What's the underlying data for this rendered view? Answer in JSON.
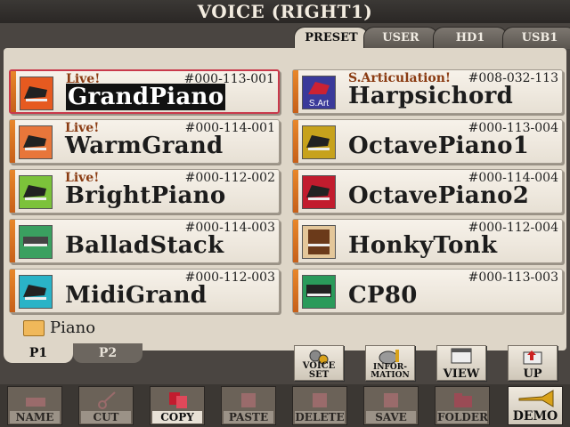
{
  "title": "VOICE (RIGHT1)",
  "tabs": [
    {
      "label": "PRESET",
      "active": true
    },
    {
      "label": "USER",
      "active": false
    },
    {
      "label": "HD1",
      "active": false
    },
    {
      "label": "USB1",
      "active": false
    }
  ],
  "voices": [
    {
      "tag": "Live!",
      "number": "#000-113-001",
      "name": "GrandPiano",
      "selected": true
    },
    {
      "tag": "S.Articulation!",
      "number": "#008-032-113",
      "name": "Harpsichord",
      "icon_text": "S.Art"
    },
    {
      "tag": "Live!",
      "number": "#000-114-001",
      "name": "WarmGrand"
    },
    {
      "tag": "",
      "number": "#000-113-004",
      "name": "OctavePiano1"
    },
    {
      "tag": "Live!",
      "number": "#000-112-002",
      "name": "BrightPiano"
    },
    {
      "tag": "",
      "number": "#000-114-004",
      "name": "OctavePiano2"
    },
    {
      "tag": "",
      "number": "#000-114-003",
      "name": "BalladStack"
    },
    {
      "tag": "",
      "number": "#000-112-004",
      "name": "HonkyTonk"
    },
    {
      "tag": "",
      "number": "#000-112-003",
      "name": "MidiGrand"
    },
    {
      "tag": "",
      "number": "#000-113-003",
      "name": "CP80"
    }
  ],
  "folder": {
    "name": "Piano"
  },
  "pages": [
    {
      "label": "P1",
      "active": true
    },
    {
      "label": "P2",
      "active": false
    }
  ],
  "func_buttons": [
    {
      "label": "VOICE SET"
    },
    {
      "label": "INFOR-\nMATION"
    },
    {
      "label": "VIEW"
    },
    {
      "label": "UP"
    }
  ],
  "bottom_buttons": [
    {
      "label": "NAME",
      "enabled": false
    },
    {
      "label": "CUT",
      "enabled": false
    },
    {
      "label": "COPY",
      "enabled": true
    },
    {
      "label": "PASTE",
      "enabled": false
    },
    {
      "label": "DELETE",
      "enabled": false
    },
    {
      "label": "SAVE",
      "enabled": false
    },
    {
      "label": "FOLDER",
      "enabled": false
    }
  ],
  "demo_label": "DEMO",
  "colors": {
    "accent_selected": "#c9394b",
    "stripe": "#e8872a",
    "tag_text": "#8a3b12"
  }
}
